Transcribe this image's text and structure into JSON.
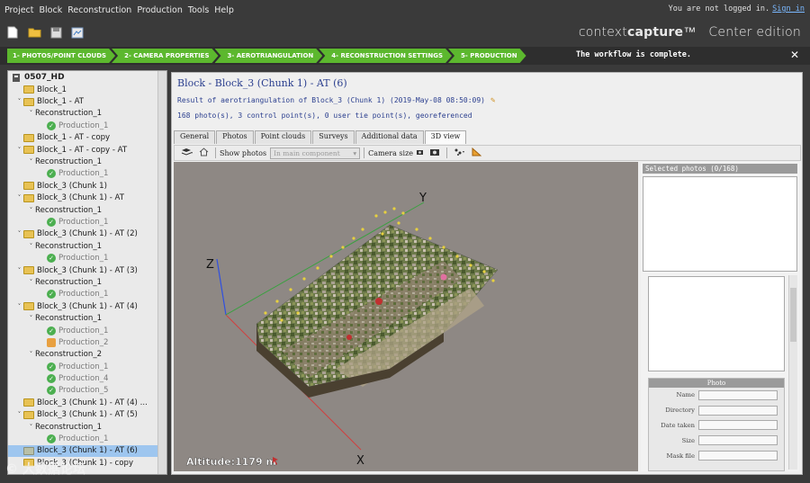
{
  "menu": {
    "items": [
      "Project",
      "Block",
      "Reconstruction",
      "Production",
      "Tools",
      "Help"
    ],
    "login_text": "You are not logged in.",
    "login_link": "Sign in"
  },
  "toolbar": {
    "buttons": [
      "new-icon",
      "open-folder-icon",
      "save-icon",
      "export-icon"
    ]
  },
  "brand": {
    "name_light": "context",
    "name_bold": "capture",
    "tm": "™",
    "edition": "Center edition"
  },
  "workflow": {
    "steps": [
      "1- PHOTOS/POINT CLOUDS",
      "2- CAMERA PROPERTIES",
      "3- AEROTRIANGULATION",
      "4- RECONSTRUCTION SETTINGS",
      "5- PRODUCTION"
    ],
    "message": "The workflow is complete.",
    "close": "✕",
    "accent": "#5cb82e"
  },
  "tree": {
    "root": "0507_HD",
    "items": [
      {
        "label": "Block_1",
        "level": 0,
        "type": "folder",
        "caret": ""
      },
      {
        "label": "Block_1 - AT",
        "level": 0,
        "type": "folder",
        "caret": "˅"
      },
      {
        "label": "Reconstruction_1",
        "level": 1,
        "type": "none",
        "caret": "˅"
      },
      {
        "label": "Production_1",
        "level": 2,
        "type": "check",
        "caret": ""
      },
      {
        "label": "Block_1 - AT - copy",
        "level": 0,
        "type": "folder",
        "caret": ""
      },
      {
        "label": "Block_1 - AT - copy - AT",
        "level": 0,
        "type": "folder",
        "caret": "˅"
      },
      {
        "label": "Reconstruction_1",
        "level": 1,
        "type": "none",
        "caret": "˅"
      },
      {
        "label": "Production_1",
        "level": 2,
        "type": "check",
        "caret": ""
      },
      {
        "label": "Block_3 (Chunk 1)",
        "level": 0,
        "type": "folder",
        "caret": ""
      },
      {
        "label": "Block_3 (Chunk 1) - AT",
        "level": 0,
        "type": "folder",
        "caret": "˅"
      },
      {
        "label": "Reconstruction_1",
        "level": 1,
        "type": "none",
        "caret": "˅"
      },
      {
        "label": "Production_1",
        "level": 2,
        "type": "check",
        "caret": ""
      },
      {
        "label": "Block_3 (Chunk 1) - AT (2)",
        "level": 0,
        "type": "folder",
        "caret": "˅"
      },
      {
        "label": "Reconstruction_1",
        "level": 1,
        "type": "none",
        "caret": "˅"
      },
      {
        "label": "Production_1",
        "level": 2,
        "type": "check",
        "caret": ""
      },
      {
        "label": "Block_3 (Chunk 1) - AT (3)",
        "level": 0,
        "type": "folder",
        "caret": "˅"
      },
      {
        "label": "Reconstruction_1",
        "level": 1,
        "type": "none",
        "caret": "˅"
      },
      {
        "label": "Production_1",
        "level": 2,
        "type": "check",
        "caret": ""
      },
      {
        "label": "Block_3 (Chunk 1) - AT (4)",
        "level": 0,
        "type": "folder",
        "caret": "˅"
      },
      {
        "label": "Reconstruction_1",
        "level": 1,
        "type": "none",
        "caret": "˅"
      },
      {
        "label": "Production_1",
        "level": 2,
        "type": "check",
        "caret": ""
      },
      {
        "label": "Production_2",
        "level": 2,
        "type": "orange",
        "caret": ""
      },
      {
        "label": "Reconstruction_2",
        "level": 1,
        "type": "none",
        "caret": "˅"
      },
      {
        "label": "Production_1",
        "level": 2,
        "type": "check",
        "caret": ""
      },
      {
        "label": "Production_4",
        "level": 2,
        "type": "check",
        "caret": ""
      },
      {
        "label": "Production_5",
        "level": 2,
        "type": "check",
        "caret": ""
      },
      {
        "label": "Block_3 (Chunk 1) - AT (4) ...",
        "level": 0,
        "type": "folder",
        "caret": ""
      },
      {
        "label": "Block_3 (Chunk 1) - AT (5)",
        "level": 0,
        "type": "folder",
        "caret": "˅"
      },
      {
        "label": "Reconstruction_1",
        "level": 1,
        "type": "none",
        "caret": "˅"
      },
      {
        "label": "Production_1",
        "level": 2,
        "type": "check",
        "caret": ""
      },
      {
        "label": "Block_3 (Chunk 1) - AT (6)",
        "level": 0,
        "type": "grey",
        "caret": "",
        "selected": true
      },
      {
        "label": "Block_3 (Chunk 1) - copy",
        "level": 0,
        "type": "folder",
        "caret": ""
      }
    ]
  },
  "main": {
    "title": "Block - Block_3 (Chunk 1) - AT (6)",
    "subtitle": "Result of aerotriangulation of Block_3 (Chunk 1) (2019-May-08 08:50:09)",
    "summary": "168 photo(s), 3 control point(s), 0 user tie point(s), georeferenced",
    "tabs": [
      "General",
      "Photos",
      "Point clouds",
      "Surveys",
      "Additional data",
      "3D view"
    ],
    "active_tab": "3D view"
  },
  "view3d": {
    "show_photos_label": "Show photos",
    "component_select": "In main component",
    "camera_size_label": "Camera size",
    "altitude_label": "Altitude:",
    "altitude_value": "1179 m",
    "axis_x": "X",
    "axis_y": "Y",
    "axis_z": "Z"
  },
  "side": {
    "selected_header": "Selected photos (0/168)",
    "photo_header": "Photo",
    "fields": [
      "Name",
      "Directory",
      "Date taken",
      "Size",
      "Mask file"
    ]
  },
  "watermark": "© 大数据论坛"
}
